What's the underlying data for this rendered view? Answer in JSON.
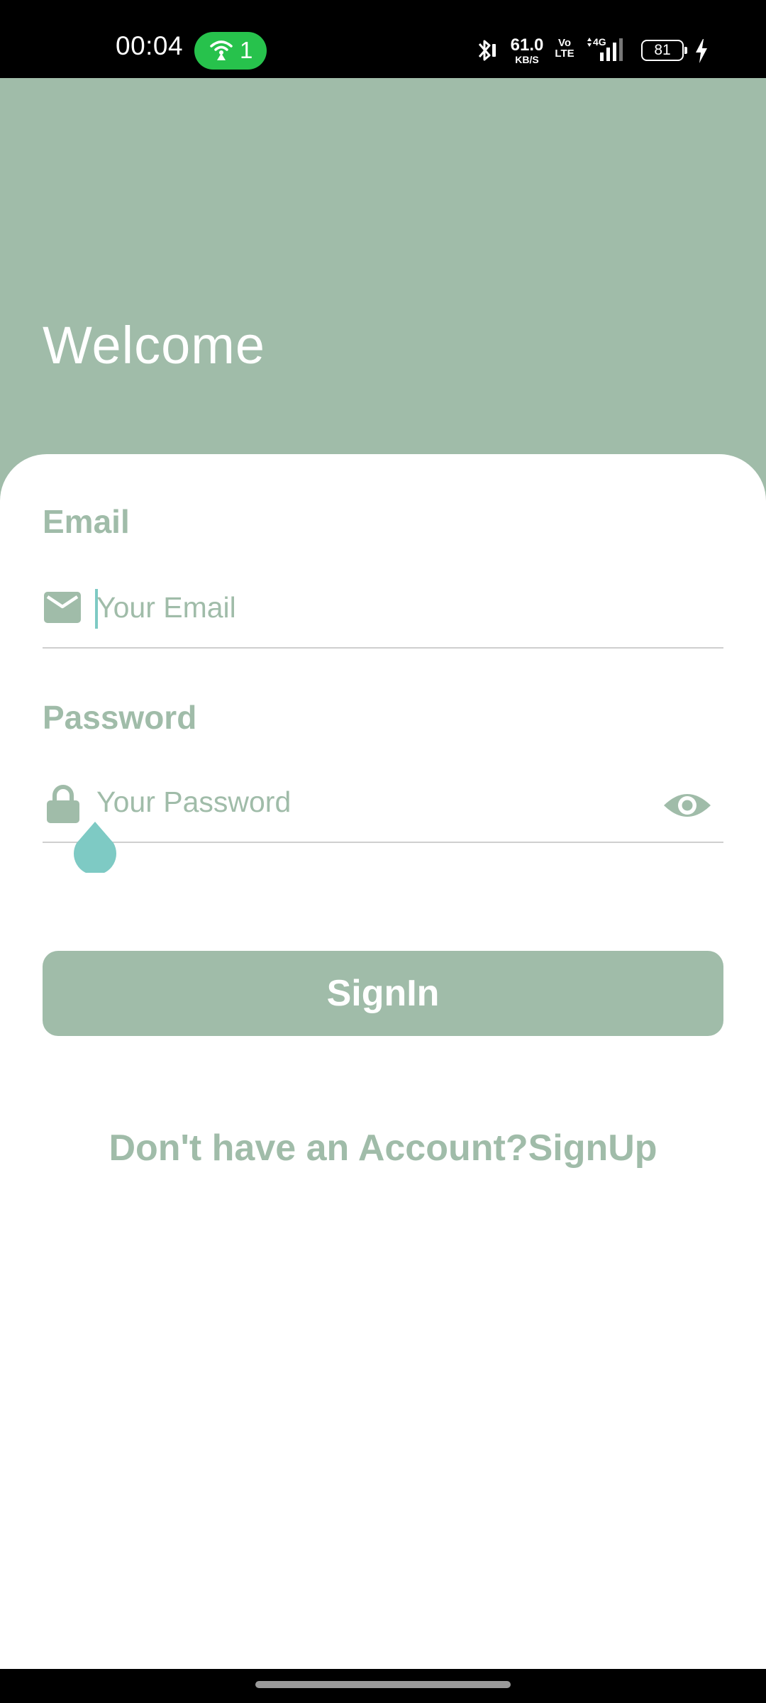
{
  "status_bar": {
    "time": "00:04",
    "hotspot_count": "1",
    "net_speed_value": "61.0",
    "net_speed_unit": "KB/S",
    "volte_top": "Vo",
    "volte_bottom": "LTE",
    "network_type": "4G",
    "battery_level": "81"
  },
  "header": {
    "title": "Welcome"
  },
  "form": {
    "email_label": "Email",
    "email_placeholder": "Your Email",
    "password_label": "Password",
    "password_placeholder": "Your Password",
    "signin_label": "SignIn",
    "signup_prompt": "Don't have an Account?SignUp"
  },
  "colors": {
    "accent": "#a0bca9",
    "caret": "#7ecac4",
    "hotspot": "#27c24c"
  },
  "icons": {
    "email": "mail-icon",
    "password": "lock-icon",
    "visibility": "eye-icon"
  }
}
